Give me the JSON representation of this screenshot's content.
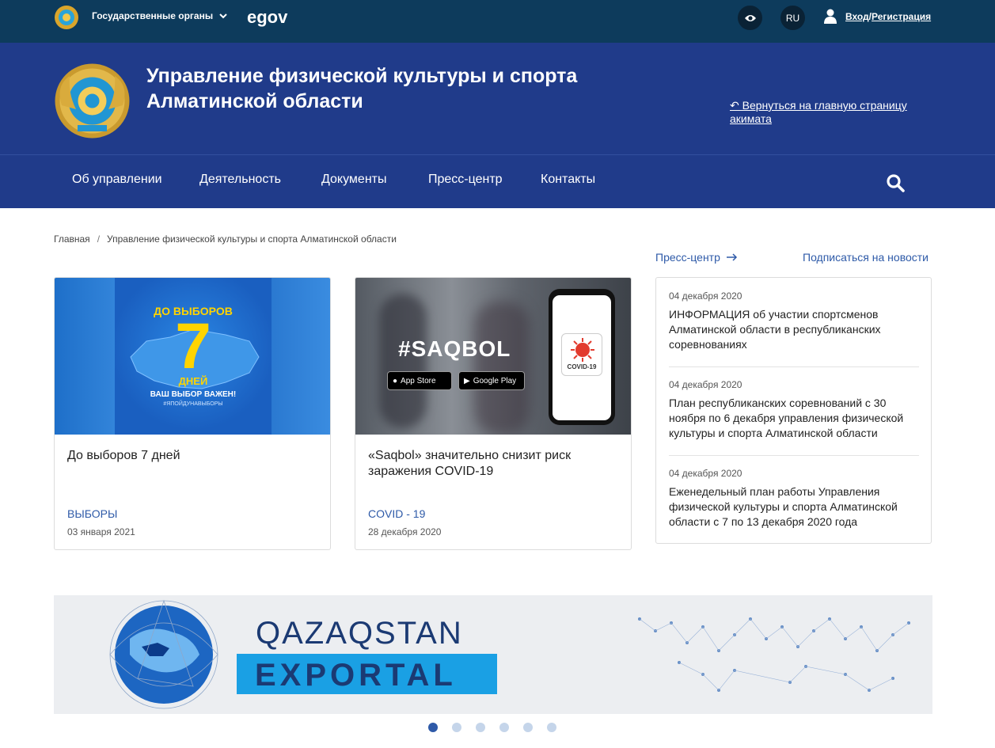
{
  "topbar": {
    "gov_label": "Государственные органы",
    "egov_logo": "egov",
    "eye_icon": "eye-icon",
    "lang": "RU",
    "login": "Вход",
    "login_sep": "/",
    "register": "Регистрация"
  },
  "header": {
    "title_line1": "Управление физической культуры и спорта",
    "title_line2": "Алматинской области",
    "back_link": "↶ Вернуться на главную страницу акимата"
  },
  "nav": {
    "items": [
      "Об управлении",
      "Деятельность",
      "Документы",
      "Пресс-центр",
      "Контакты"
    ]
  },
  "breadcrumb": {
    "home": "Главная",
    "sep": "/",
    "current": "Управление физической культуры и спорта Алматинской области"
  },
  "cards": [
    {
      "img": {
        "line1": "ДО ВЫБОРОВ",
        "number": "7",
        "line2": "ДНЕЙ",
        "line3": "ВАШ ВЫБОР ВАЖЕН!",
        "line4": "#ЯПОЙДУНАВЫБОРЫ"
      },
      "title": "До выборов 7 дней",
      "tag": "ВЫБОРЫ",
      "date": "03 января 2021"
    },
    {
      "img": {
        "hashtag": "#SAQBOL",
        "appstore": "App Store",
        "gplay": "Google Play",
        "covid": "COVID-19"
      },
      "title": "«Saqbol» значительно снизит риск заражения COVID-19",
      "tag": "COVID - 19",
      "date": "28 декабря 2020"
    }
  ],
  "news": {
    "press_link": "Пресс-центр",
    "subscribe": "Подписаться на новости",
    "items": [
      {
        "date": "04 декабря 2020",
        "text": "ИНФОРМАЦИЯ об участии спортсменов Алматинской области в республиканских соревнованиях"
      },
      {
        "date": "04 декабря 2020",
        "text": "План республиканских соревнований с 30 ноября по 6 декабря управления физической культуры и спорта Алматинской области"
      },
      {
        "date": "04 декабря 2020",
        "text": "Еженедельный план работы Управления физической культуры и спорта Алматинской области с 7 по 13 декабря 2020 года"
      }
    ]
  },
  "banner": {
    "line1": "QAZAQSTAN",
    "line2": "EXPORTAL"
  },
  "carousel": {
    "active_index": 0
  },
  "colors": {
    "topbar": "#0d3b5c",
    "header": "#203b8a",
    "link": "#2e5aa8",
    "banner_accent": "#1aa0e4"
  }
}
